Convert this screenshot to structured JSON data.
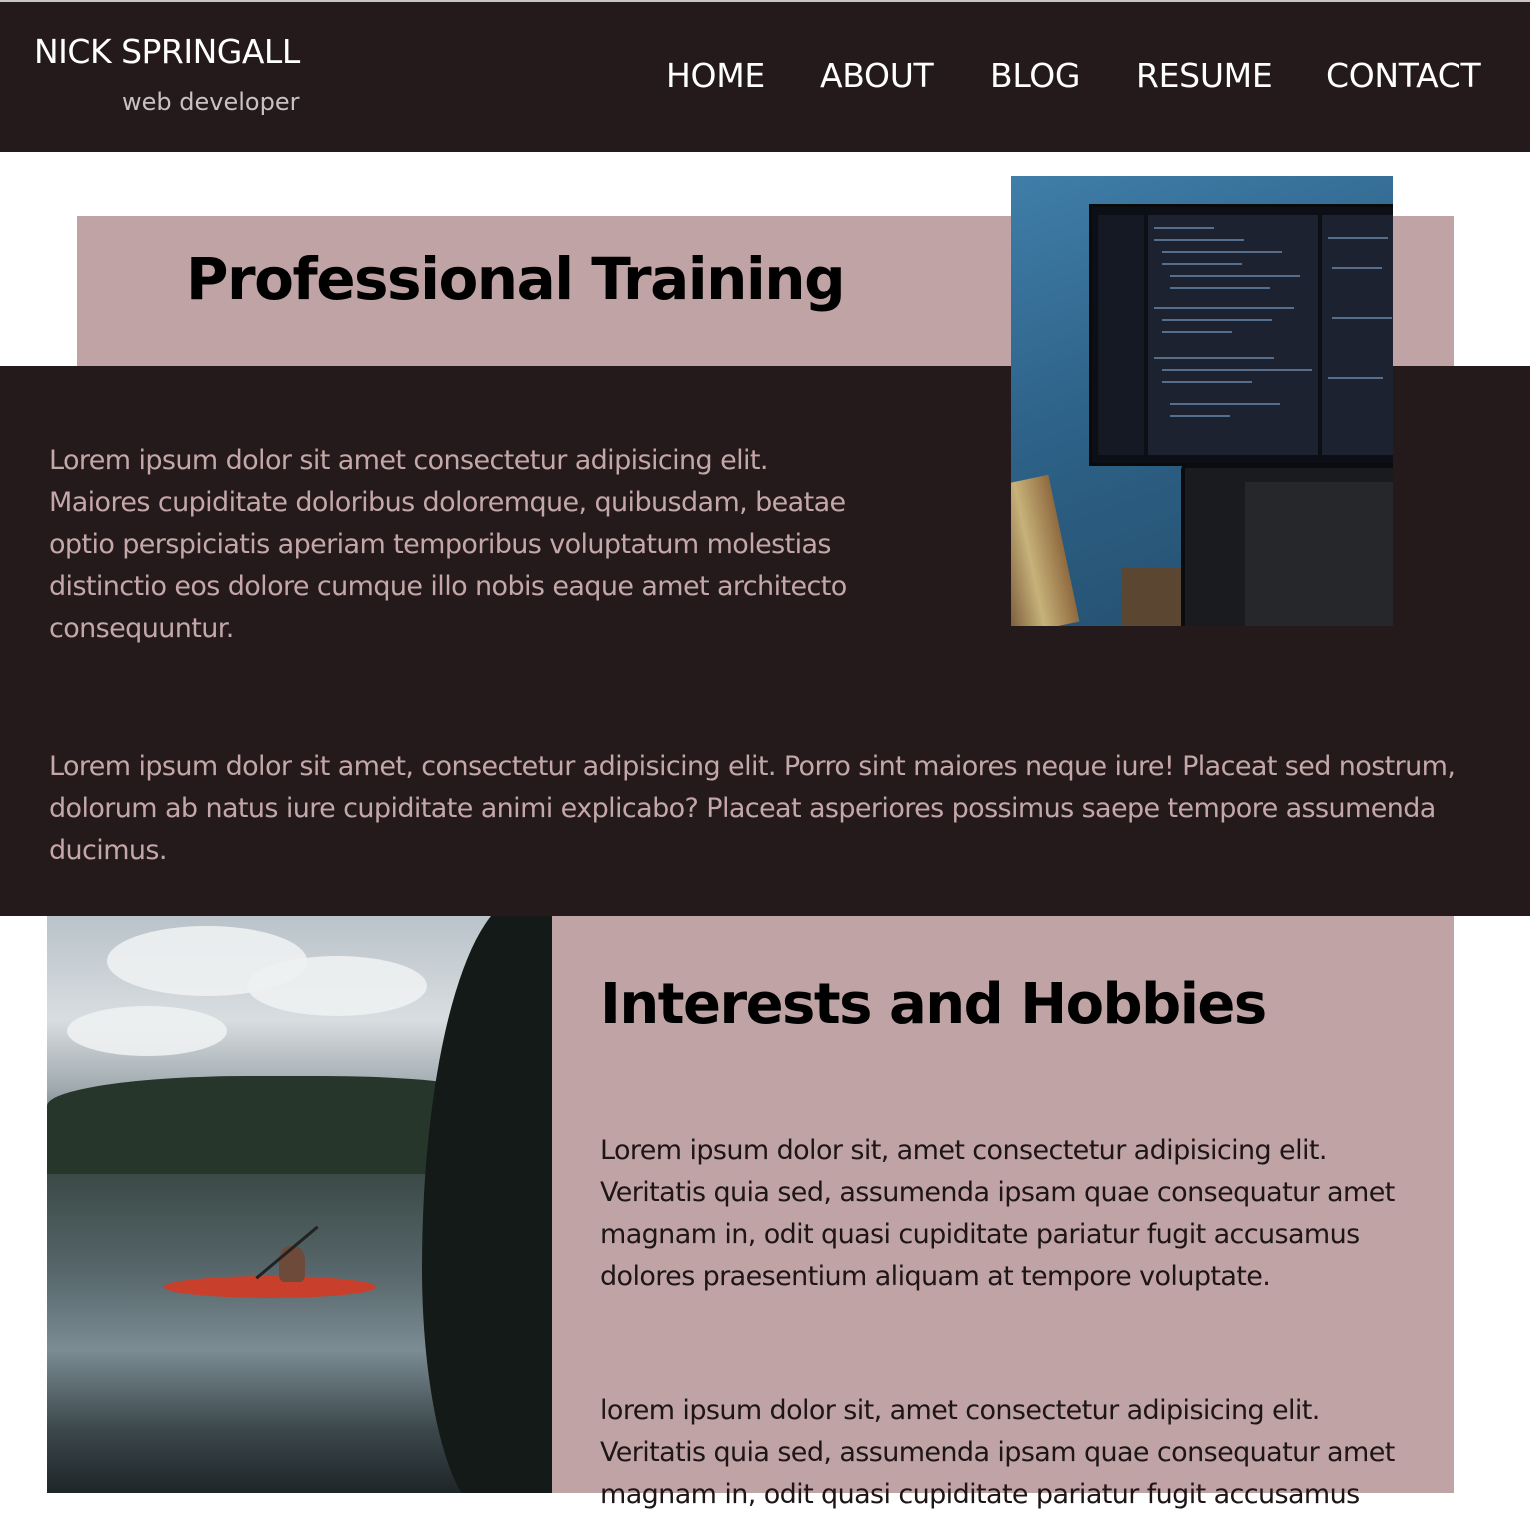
{
  "header": {
    "brand_name": "NICK SPRINGALL",
    "brand_tagline": "web developer",
    "nav": [
      {
        "label": "HOME"
      },
      {
        "label": "ABOUT"
      },
      {
        "label": "BLOG"
      },
      {
        "label": "RESUME"
      },
      {
        "label": "CONTACT"
      }
    ]
  },
  "training": {
    "title": "Professional Training",
    "para1": "Lorem ipsum dolor sit amet consectetur adipisicing elit. Maiores cupiditate doloribus doloremque, quibusdam, beatae optio perspiciatis aperiam temporibus voluptatum molestias distinctio eos dolore cumque illo nobis eaque amet architecto consequuntur.",
    "para2": "Lorem ipsum dolor sit amet, consectetur adipisicing elit. Porro sint maiores neque iure! Placeat sed nostrum, dolorum ab natus iure cupiditate animi explicabo? Placeat asperiores possimus saepe tempore assumenda ducimus."
  },
  "hobbies": {
    "title": "Interests and Hobbies",
    "para1": "Lorem ipsum dolor sit, amet consectetur adipisicing elit. Veritatis quia sed, assumenda ipsam quae consequatur amet magnam in, odit quasi cupiditate pariatur fugit accusamus dolores praesentium aliquam at tempore voluptate.",
    "para2": "lorem ipsum dolor sit, amet consectetur adipisicing elit. Veritatis quia sed, assumenda ipsam quae consequatur amet magnam in, odit quasi cupiditate pariatur fugit accusamus"
  },
  "colors": {
    "header_bg": "#251a1b",
    "accent_pink": "#c0a3a5",
    "body_text_on_dark": "#c4a7a9"
  }
}
